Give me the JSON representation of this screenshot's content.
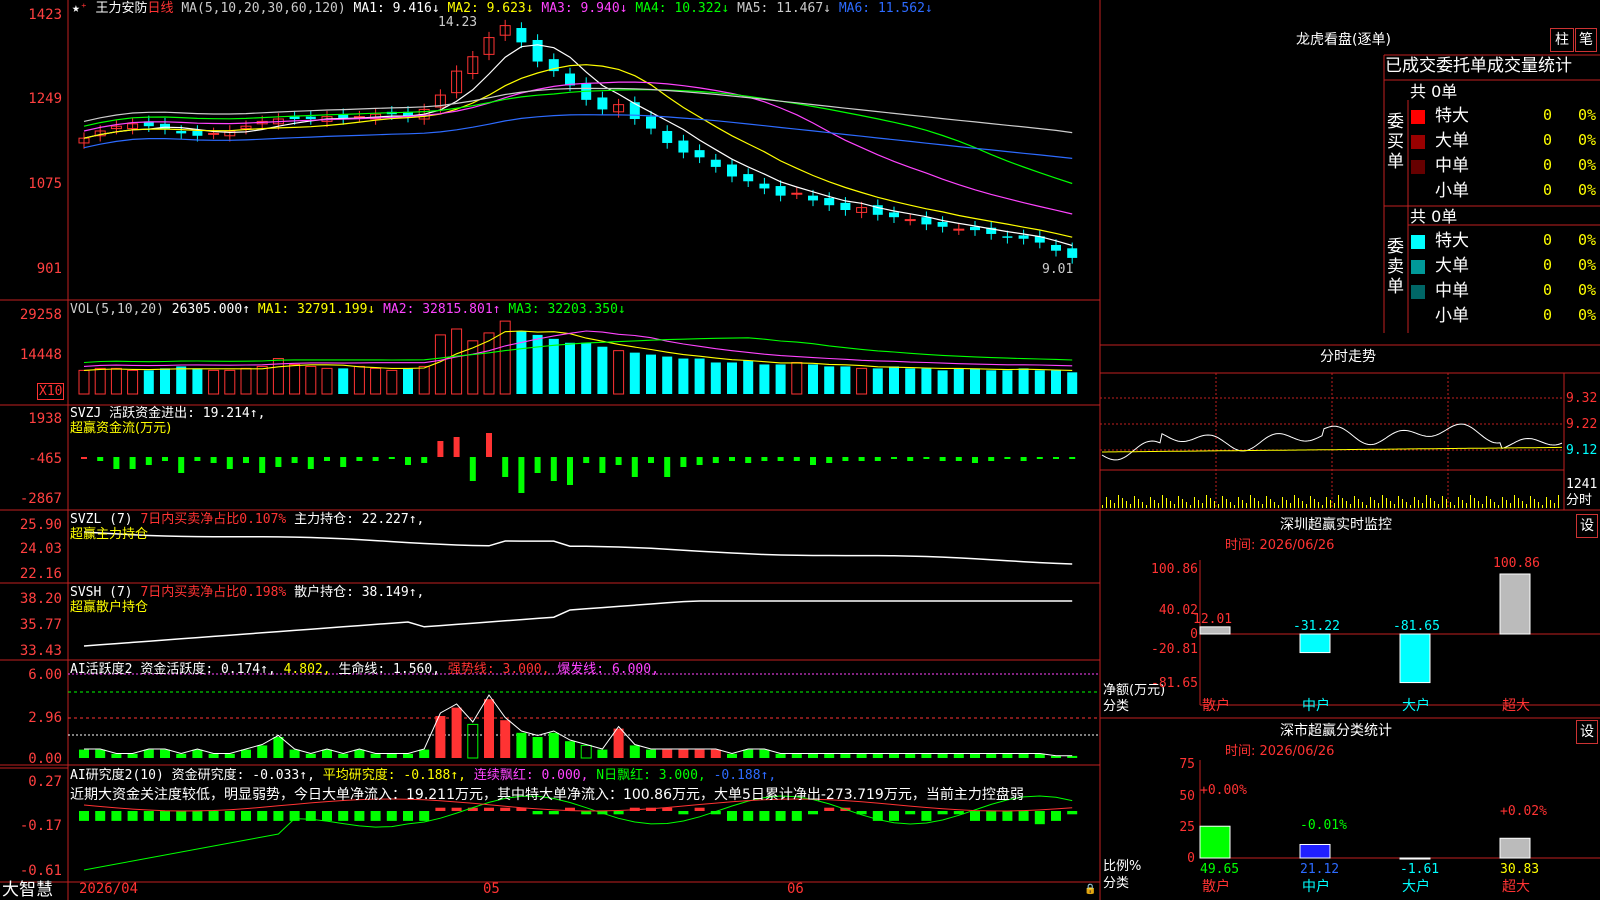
{
  "stock": {
    "name": "王力安防",
    "period": "日线"
  },
  "main_legend": {
    "ma_params": "MA(5,10,20,30,60,120)",
    "ma1": "MA1: 9.416↓",
    "ma2": "MA2: 9.623↓",
    "ma3": "MA3: 9.940↓",
    "ma4": "MA4: 10.322↓",
    "ma5": "MA5: 11.467↓",
    "ma6": "MA6: 11.562↓"
  },
  "main_axis": [
    "1423",
    "1249",
    "1075",
    "901"
  ],
  "price_marks": {
    "high": "14.23",
    "low": "9.01"
  },
  "vol_legend": {
    "params": "VOL(5,10,20)",
    "vol": "26305.000↑",
    "ma1": "MA1: 32791.199↓",
    "ma2": "MA2: 32815.801↑",
    "ma3": "MA3: 32203.350↓"
  },
  "vol_axis": [
    "29258",
    "14448"
  ],
  "vol_unit": "X10",
  "svzj": {
    "legend1": "SVZJ  活跃资金进出: 19.214↑,",
    "legend2": "超赢资金流(万元)",
    "axis": [
      "1938",
      "-465",
      "-2867"
    ]
  },
  "svzl": {
    "legend_a": "SVZL (7)",
    "legend_b": "7日内买卖净占比0.107%",
    "legend_c": "主力持仓: 22.227↑,",
    "legend2": "超赢主力持仓",
    "axis": [
      "25.90",
      "24.03",
      "22.16"
    ]
  },
  "svsh": {
    "legend_a": "SVSH (7)",
    "legend_b": "7日内买卖净占比0.198%",
    "legend_c": "散户持仓: 38.149↑,",
    "legend2": "超赢散户持仓",
    "axis": [
      "38.20",
      "35.77",
      "33.43"
    ]
  },
  "ai1": {
    "legend_a": "AI活跃度2",
    "legend_b": "资金活跃度: 0.174↑,",
    "legend_c": "4.802,",
    "legend_d": "生命线: 1.560,",
    "legend_e": "强势线: 3.000,",
    "legend_f": "爆发线: 6.000,",
    "axis": [
      "6.00",
      "2.96",
      "0.00"
    ]
  },
  "ai2": {
    "legend_a": "AI研究度2(10)",
    "legend_b": "资金研究度: -0.033↑,",
    "legend_c": "平均研究度: -0.188↑,",
    "legend_d": "连续飘红: 0.000,",
    "legend_e": "N日飘红: 3.000,",
    "legend_f": "-0.188↑,",
    "comment": "近期大资金关注度较低，明显弱势，今日大单净流入：19.211万元，其中特大单净流入：100.86万元，大单5日累计净出-273.719万元，当前主力控盘弱",
    "axis": [
      "0.27",
      "-0.17",
      "-0.61"
    ]
  },
  "bottom": {
    "brand": "大智慧",
    "dates": [
      "2026/04",
      "05",
      "06"
    ]
  },
  "right_panel": {
    "title": "龙虎看盘(逐单)",
    "btn_zhu": "柱",
    "btn_bi": "笔",
    "table_title": "已成交委托单成交量统计",
    "buy_label": "委买单",
    "sell_label": "委卖单",
    "buy_total": "共 0单",
    "sell_total": "共 0单",
    "rows": [
      {
        "name": "特大",
        "count": "0",
        "pct": "0%",
        "color": "#ff0000"
      },
      {
        "name": "大单",
        "count": "0",
        "pct": "0%",
        "color": "#990000"
      },
      {
        "name": "中单",
        "count": "0",
        "pct": "0%",
        "color": "#660000"
      },
      {
        "name": "小单",
        "count": "0",
        "pct": "0%",
        "color": "#000000"
      }
    ],
    "sell_rows": [
      {
        "name": "特大",
        "count": "0",
        "pct": "0%",
        "color": "#00ffff"
      },
      {
        "name": "大单",
        "count": "0",
        "pct": "0%",
        "color": "#009999"
      },
      {
        "name": "中单",
        "count": "0",
        "pct": "0%",
        "color": "#006666"
      },
      {
        "name": "小单",
        "count": "0",
        "pct": "0%",
        "color": "#000000"
      }
    ],
    "intraday_title": "分时走势",
    "intraday_axis": [
      "9.32",
      "9.22",
      "9.12"
    ],
    "intraday_vol_label": "1241",
    "intraday_vol_label2": "分时",
    "monitor_title": "深圳超赢实时监控",
    "btn_set": "设",
    "monitor_time": "时间: 2026/06/26",
    "monitor_axis": [
      "100.86",
      "40.02",
      "0",
      "-20.81",
      "-81.65"
    ],
    "monitor_bars": [
      {
        "label": "散户",
        "value": 12.01,
        "text": "12.01"
      },
      {
        "label": "中户",
        "value": -31.22,
        "text": "-31.22"
      },
      {
        "label": "大户",
        "value": -81.65,
        "text": "-81.65"
      },
      {
        "label": "超大",
        "value": 100.86,
        "text": "100.86"
      }
    ],
    "monitor_ylabel": "净额(万元)",
    "monitor_xlabel": "分类",
    "class_title": "深市超赢分类统计",
    "class_time": "时间: 2026/06/26",
    "class_axis": [
      "75",
      "50",
      "25",
      "0"
    ],
    "class_bars": [
      {
        "label": "散户",
        "value": 49.65,
        "text": "49.65",
        "top": "+0.00%"
      },
      {
        "label": "中户",
        "value": 21.12,
        "text": "21.12",
        "top": "-0.01%"
      },
      {
        "label": "大户",
        "value": -1.61,
        "text": "-1.61",
        "top": ""
      },
      {
        "label": "超大",
        "value": 30.83,
        "text": "30.83",
        "top": "+0.02%"
      }
    ],
    "class_ylabel": "比例%",
    "class_xlabel": "分类"
  }
}
